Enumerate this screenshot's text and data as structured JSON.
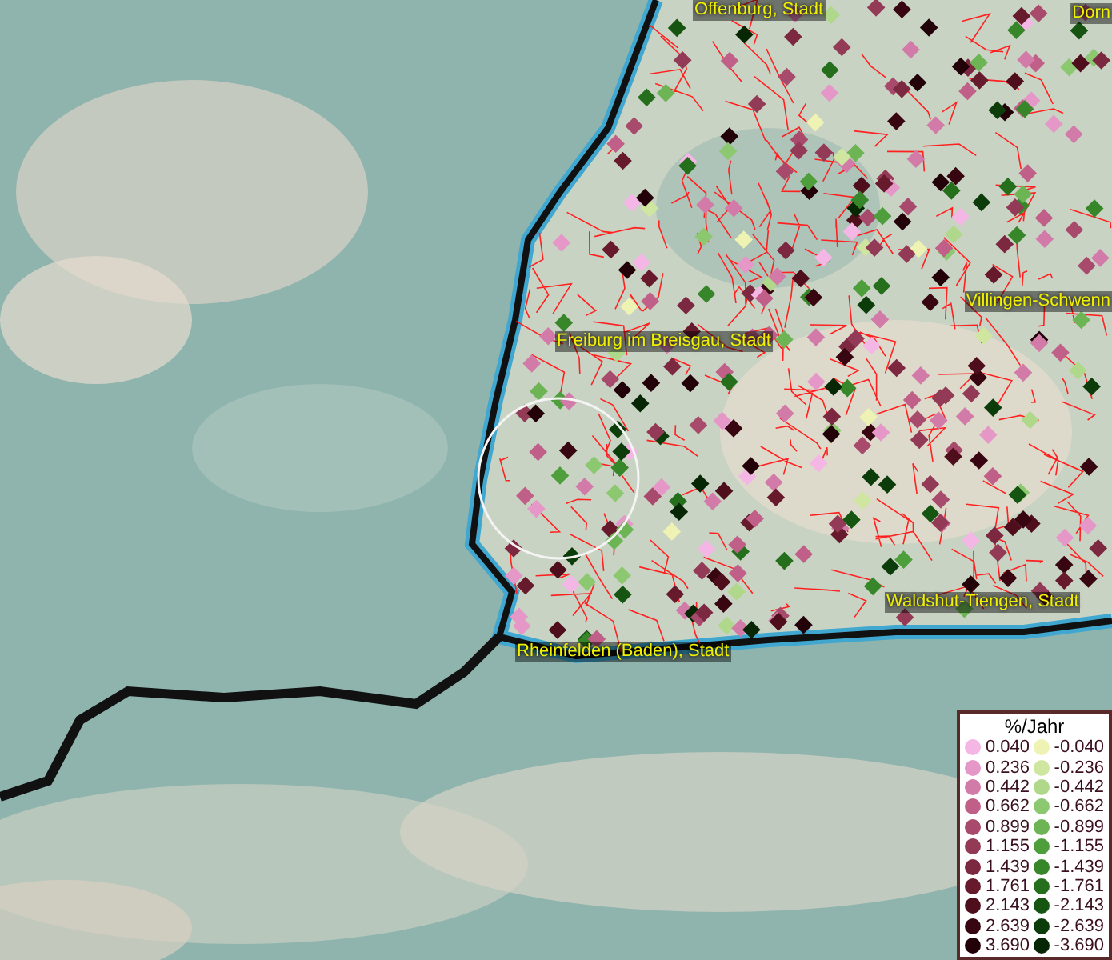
{
  "map": {
    "places": [
      {
        "label": "Offenburg, Stadt"
      },
      {
        "label": "Dorn"
      },
      {
        "label": "Villingen-Schwenn"
      },
      {
        "label": "Freiburg im Breisgau, Stadt"
      },
      {
        "label": "Waldshut-Tiengen, Stadt"
      },
      {
        "label": "Rheinfelden (Baden), Stadt"
      }
    ]
  },
  "legend": {
    "title": "%/Jahr",
    "rows": [
      {
        "positive": {
          "value": "0.040",
          "color": "#f4b6e4"
        },
        "negative": {
          "value": "-0.040",
          "color": "#eef3b4"
        }
      },
      {
        "positive": {
          "value": "0.236",
          "color": "#e597c8"
        },
        "negative": {
          "value": "-0.236",
          "color": "#cfe6a0"
        }
      },
      {
        "positive": {
          "value": "0.442",
          "color": "#d27aa8"
        },
        "negative": {
          "value": "-0.442",
          "color": "#afd88a"
        }
      },
      {
        "positive": {
          "value": "0.662",
          "color": "#c06088"
        },
        "negative": {
          "value": "-0.662",
          "color": "#8cc870"
        }
      },
      {
        "positive": {
          "value": "0.899",
          "color": "#a84a6c"
        },
        "negative": {
          "value": "-0.899",
          "color": "#6cb454"
        }
      },
      {
        "positive": {
          "value": "1.155",
          "color": "#933a56"
        },
        "negative": {
          "value": "-1.155",
          "color": "#4e9e3c"
        }
      },
      {
        "positive": {
          "value": "1.439",
          "color": "#7c2840"
        },
        "negative": {
          "value": "-1.439",
          "color": "#38862a"
        }
      },
      {
        "positive": {
          "value": "1.761",
          "color": "#661a2c"
        },
        "negative": {
          "value": "-1.761",
          "color": "#246e1c"
        }
      },
      {
        "positive": {
          "value": "2.143",
          "color": "#4e0e1c"
        },
        "negative": {
          "value": "-2.143",
          "color": "#165412"
        }
      },
      {
        "positive": {
          "value": "2.639",
          "color": "#380610"
        },
        "negative": {
          "value": "-2.639",
          "color": "#0c3c0a"
        }
      },
      {
        "positive": {
          "value": "3.690",
          "color": "#220208"
        },
        "negative": {
          "value": "-3.690",
          "color": "#062604"
        }
      }
    ]
  }
}
